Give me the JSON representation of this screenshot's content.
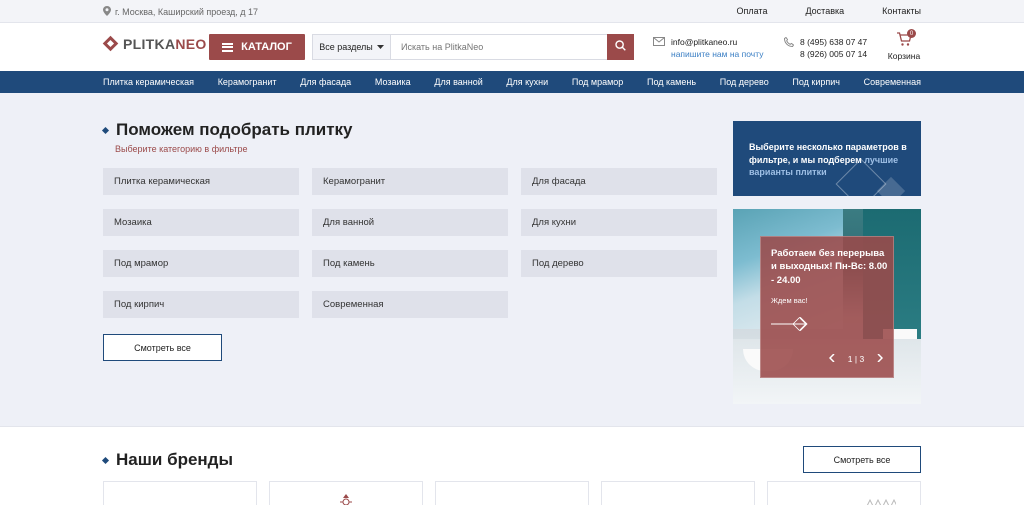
{
  "topbar": {
    "address": "г. Москва, Каширский проезд, д 17",
    "links": [
      "Оплата",
      "Доставка",
      "Контакты"
    ]
  },
  "header": {
    "logo_part1": "PLITKA",
    "logo_part2": "NEO",
    "catalog_label": "КАТАЛОГ",
    "search_scope": "Все разделы",
    "search_placeholder": "Искать на PlitkaNeo",
    "email": "info@plitkaneo.ru",
    "email_link": "напишите нам на почту",
    "phone1": "8 (495) 638 07 47",
    "phone2": "8 (926) 005 07 14",
    "cart_label": "Корзина",
    "cart_count": "0"
  },
  "nav": {
    "items": [
      "Плитка керамическая",
      "Керамогранит",
      "Для фасада",
      "Мозаика",
      "Для ванной",
      "Для кухни",
      "Под мрамор",
      "Под камень",
      "Под дерево",
      "Под кирпич",
      "Современная"
    ]
  },
  "picker": {
    "title": "Поможем подобрать плитку",
    "subtitle": "Выберите категорию в фильтре",
    "tiles": [
      "Плитка керамическая",
      "Керамогранит",
      "Для фасада",
      "Мозаика",
      "Для ванной",
      "Для кухни",
      "Под мрамор",
      "Под камень",
      "Под дерево",
      "Под кирпич",
      "Современная"
    ],
    "see_all": "Смотреть все"
  },
  "promo1": {
    "text": "Выберите несколько параметров в фильтре, и мы подберем ",
    "highlight": "лучшие варианты плитки"
  },
  "promo2": {
    "title": "Работаем без перерыва и выходных! Пн-Вс: 8.00 - 24.00",
    "subtitle": "Ждем вас!",
    "pager": "1 | 3"
  },
  "brands": {
    "title": "Наши бренды",
    "see_all": "Смотреть все"
  },
  "colors": {
    "accent": "#9b4a4a",
    "navy": "#1f4a7b",
    "link": "#3b7fc4"
  }
}
